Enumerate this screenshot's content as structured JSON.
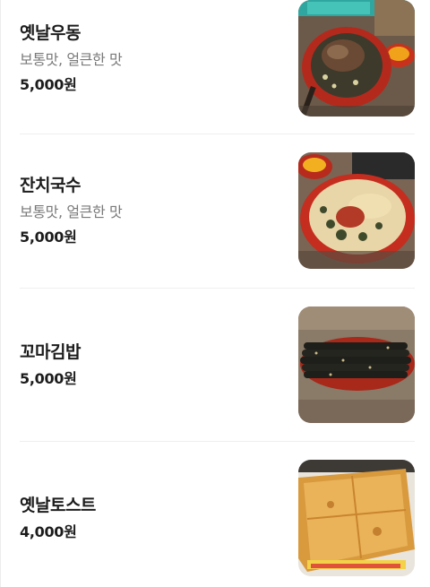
{
  "menu": {
    "items": [
      {
        "name": "옛날우동",
        "desc": "보통맛, 얼큰한 맛",
        "price": "5,000원",
        "image": "udon-bowl-photo"
      },
      {
        "name": "잔치국수",
        "desc": "보통맛, 얼큰한 맛",
        "price": "5,000원",
        "image": "janchi-guksu-bowl-photo"
      },
      {
        "name": "꼬마김밥",
        "desc": "",
        "price": "5,000원",
        "image": "mini-gimbap-plate-photo"
      },
      {
        "name": "옛날토스트",
        "desc": "",
        "price": "4,000원",
        "image": "toast-sandwich-photo"
      }
    ]
  }
}
